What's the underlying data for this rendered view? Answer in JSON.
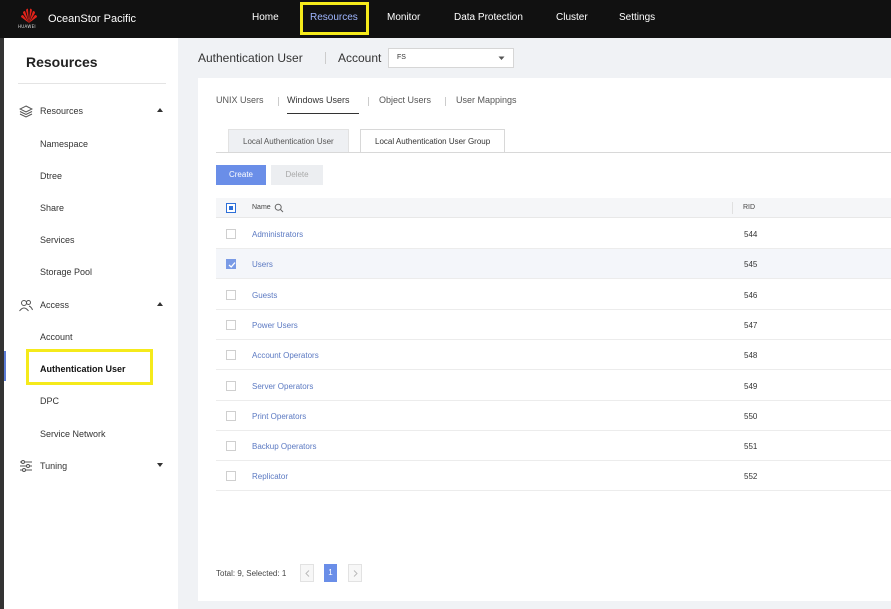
{
  "app": {
    "brand_name": "OceanStor Pacific",
    "logo_text": "HUAWEI"
  },
  "topnav": {
    "items": [
      {
        "label": "Home"
      },
      {
        "label": "Resources"
      },
      {
        "label": "Monitor"
      },
      {
        "label": "Data Protection"
      },
      {
        "label": "Cluster"
      },
      {
        "label": "Settings"
      }
    ],
    "active": "Resources"
  },
  "sidebar": {
    "title": "Resources",
    "groups": [
      {
        "label": "Resources",
        "icon": "layers-icon",
        "expanded": true,
        "items": [
          {
            "label": "Namespace"
          },
          {
            "label": "Dtree"
          },
          {
            "label": "Share"
          },
          {
            "label": "Services"
          },
          {
            "label": "Storage Pool"
          }
        ]
      },
      {
        "label": "Access",
        "icon": "users-icon",
        "expanded": true,
        "items": [
          {
            "label": "Account"
          },
          {
            "label": "Authentication User"
          },
          {
            "label": "DPC"
          },
          {
            "label": "Service Network"
          }
        ]
      },
      {
        "label": "Tuning",
        "icon": "sliders-icon",
        "expanded": false,
        "items": []
      }
    ],
    "active_item": "Authentication User"
  },
  "header": {
    "title": "Authentication User",
    "account_label": "Account",
    "account_value": "FS"
  },
  "subtabs": [
    {
      "label": "UNIX Users"
    },
    {
      "label": "Windows Users"
    },
    {
      "label": "Object Users"
    },
    {
      "label": "User Mappings"
    }
  ],
  "active_subtab": "Windows Users",
  "inner_tabs": [
    {
      "label": "Local Authentication User"
    },
    {
      "label": "Local Authentication User Group"
    }
  ],
  "active_inner_tab": "Local Authentication User Group",
  "toolbar": {
    "create_label": "Create",
    "delete_label": "Delete"
  },
  "table": {
    "columns": [
      {
        "label": "Name"
      },
      {
        "label": "RID"
      }
    ],
    "rows": [
      {
        "name": "Administrators",
        "rid": "544",
        "selected": false
      },
      {
        "name": "Users",
        "rid": "545",
        "selected": true
      },
      {
        "name": "Guests",
        "rid": "546",
        "selected": false
      },
      {
        "name": "Power Users",
        "rid": "547",
        "selected": false
      },
      {
        "name": "Account Operators",
        "rid": "548",
        "selected": false
      },
      {
        "name": "Server Operators",
        "rid": "549",
        "selected": false
      },
      {
        "name": "Print Operators",
        "rid": "550",
        "selected": false
      },
      {
        "name": "Backup Operators",
        "rid": "551",
        "selected": false
      },
      {
        "name": "Replicator",
        "rid": "552",
        "selected": false
      }
    ]
  },
  "footer": {
    "total_text": "Total: 9, Selected: 1",
    "current_page": "1"
  },
  "colors": {
    "accent": "#6a8ee8",
    "highlight": "#f5ea1b",
    "link": "#5b79c2",
    "topbar": "#111111"
  }
}
